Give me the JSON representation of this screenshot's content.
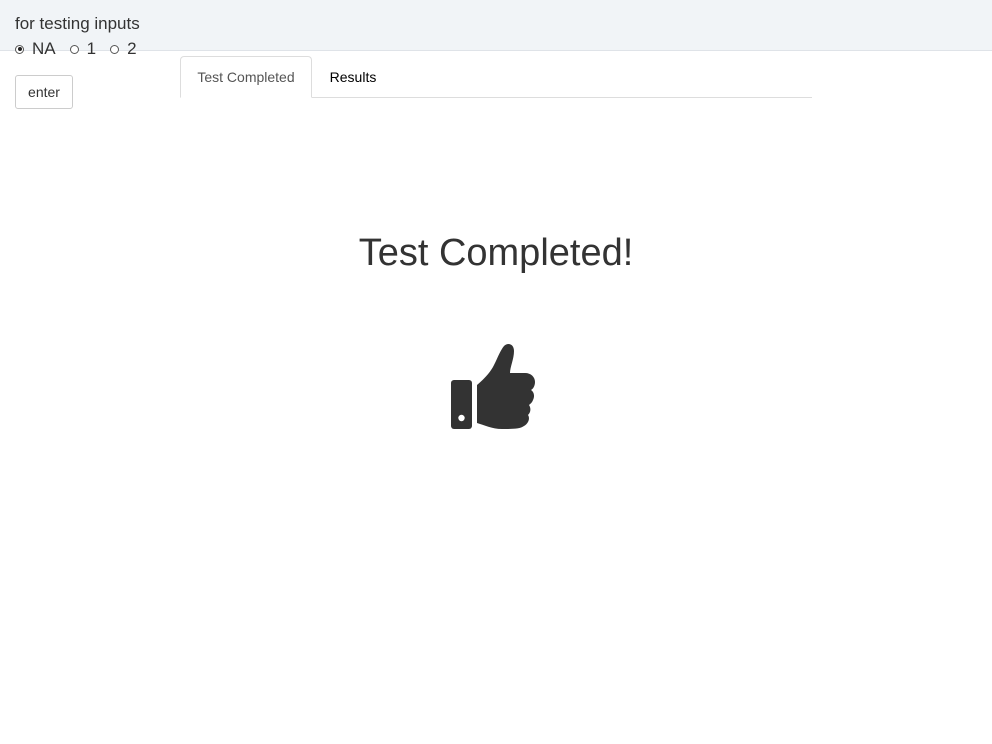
{
  "sidebar": {
    "label": "for testing inputs",
    "radio_options": [
      {
        "label": "NA",
        "checked": true
      },
      {
        "label": "1",
        "checked": false
      },
      {
        "label": "2",
        "checked": false
      }
    ],
    "enter_label": "enter"
  },
  "tabs": [
    {
      "label": "Test Completed",
      "active": true
    },
    {
      "label": "Results",
      "active": false
    }
  ],
  "main": {
    "title": "Test Completed!",
    "icon": "thumbs-up-icon"
  },
  "colors": {
    "top_band": "#f1f4f7",
    "text": "#333333",
    "icon": "#333333"
  }
}
